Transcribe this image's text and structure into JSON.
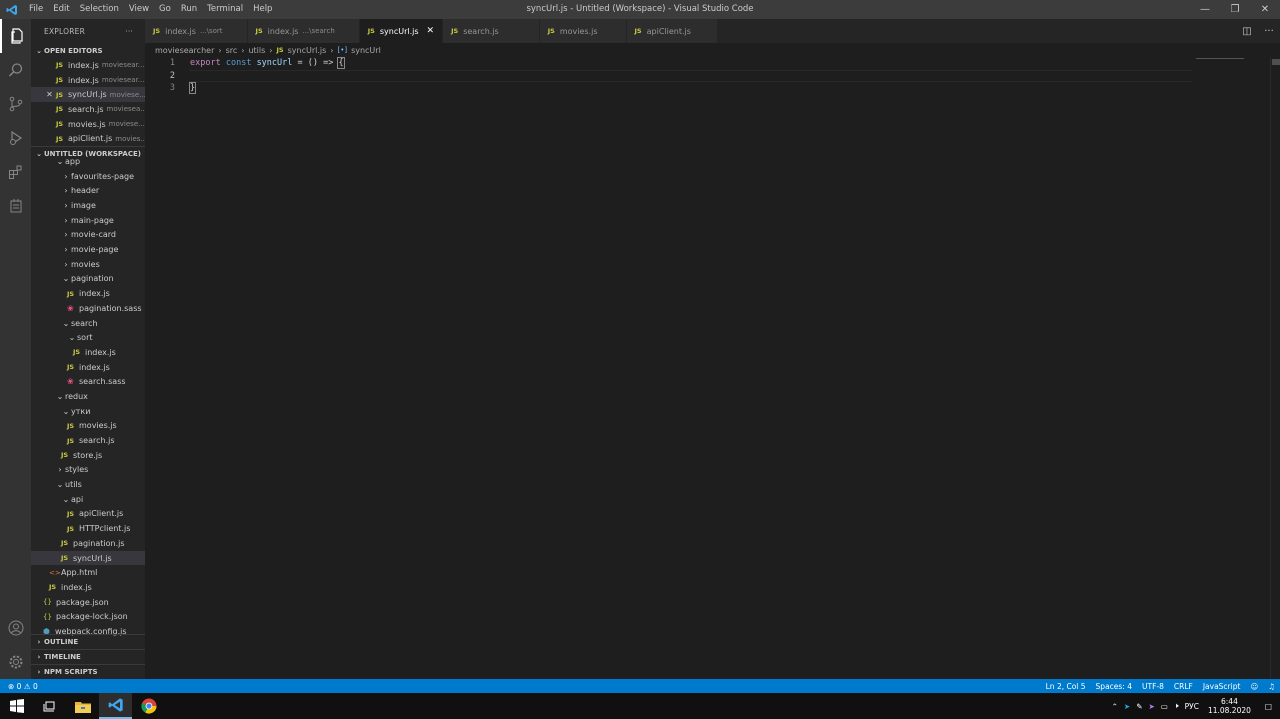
{
  "app": {
    "title": "syncUrl.js - Untitled (Workspace) - Visual Studio Code",
    "logo_icon": "vscode-logo-icon",
    "menu": [
      "File",
      "Edit",
      "Selection",
      "View",
      "Go",
      "Run",
      "Terminal",
      "Help"
    ],
    "window_controls": [
      "minimize-icon",
      "restore-icon",
      "close-icon"
    ]
  },
  "activity_bar": {
    "top": [
      "files-icon",
      "search-icon",
      "source-control-icon",
      "run-debug-icon",
      "extensions-icon",
      "remote-icon"
    ],
    "bottom": [
      "account-icon",
      "gear-icon"
    ]
  },
  "sidebar": {
    "header": "EXPLORER",
    "more": "···",
    "open_editors_title": "OPEN EDITORS",
    "open_editors": [
      {
        "name": "index.js",
        "desc": "moviesear..."
      },
      {
        "name": "index.js",
        "desc": "moviesear..."
      },
      {
        "name": "syncUrl.js",
        "desc": "moviese..."
      },
      {
        "name": "search.js",
        "desc": "moviesea..."
      },
      {
        "name": "movies.js",
        "desc": "moviese..."
      },
      {
        "name": "apiClient.js",
        "desc": "movies..."
      }
    ],
    "workspace_title": "UNTITLED (WORKSPACE)",
    "tree": [
      {
        "label": "app",
        "kind": "folder-open",
        "indent": 0
      },
      {
        "label": "favourites-page",
        "kind": "folder",
        "indent": 1
      },
      {
        "label": "header",
        "kind": "folder",
        "indent": 1
      },
      {
        "label": "image",
        "kind": "folder",
        "indent": 1
      },
      {
        "label": "main-page",
        "kind": "folder",
        "indent": 1
      },
      {
        "label": "movie-card",
        "kind": "folder",
        "indent": 1
      },
      {
        "label": "movie-page",
        "kind": "folder",
        "indent": 1
      },
      {
        "label": "movies",
        "kind": "folder",
        "indent": 1
      },
      {
        "label": "pagination",
        "kind": "folder-open",
        "indent": 1
      },
      {
        "label": "index.js",
        "kind": "js",
        "indent": 2
      },
      {
        "label": "pagination.sass",
        "kind": "sass",
        "indent": 2
      },
      {
        "label": "search",
        "kind": "folder-open",
        "indent": 1
      },
      {
        "label": "sort",
        "kind": "folder-open",
        "indent": 2
      },
      {
        "label": "index.js",
        "kind": "js",
        "indent": 3
      },
      {
        "label": "index.js",
        "kind": "js",
        "indent": 2
      },
      {
        "label": "search.sass",
        "kind": "sass",
        "indent": 2
      },
      {
        "label": "redux",
        "kind": "folder-open",
        "indent": 0
      },
      {
        "label": "утки",
        "kind": "folder-open",
        "indent": 1
      },
      {
        "label": "movies.js",
        "kind": "js",
        "indent": 2
      },
      {
        "label": "search.js",
        "kind": "js",
        "indent": 2
      },
      {
        "label": "store.js",
        "kind": "js",
        "indent": 1
      },
      {
        "label": "styles",
        "kind": "folder",
        "indent": 0
      },
      {
        "label": "utils",
        "kind": "folder-open",
        "indent": 0
      },
      {
        "label": "api",
        "kind": "folder-open",
        "indent": 1
      },
      {
        "label": "apiClient.js",
        "kind": "js",
        "indent": 2
      },
      {
        "label": "HTTPclient.js",
        "kind": "js",
        "indent": 2
      },
      {
        "label": "pagination.js",
        "kind": "js",
        "indent": 1
      },
      {
        "label": "syncUrl.js",
        "kind": "js",
        "indent": 1,
        "selected": true
      },
      {
        "label": "App.html",
        "kind": "html",
        "indent": -1
      },
      {
        "label": "index.js",
        "kind": "js",
        "indent": -1
      },
      {
        "label": "package.json",
        "kind": "json",
        "indent": -2
      },
      {
        "label": "package-lock.json",
        "kind": "json",
        "indent": -2
      },
      {
        "label": "webpack.config.js",
        "kind": "webpack",
        "indent": -2
      }
    ],
    "outline_title": "OUTLINE",
    "timeline_title": "TIMELINE",
    "npm_title": "NPM SCRIPTS"
  },
  "tabs": [
    {
      "name": "index.js",
      "desc": "...\\sort",
      "active": false
    },
    {
      "name": "index.js",
      "desc": "...\\search",
      "active": false
    },
    {
      "name": "syncUrl.js",
      "desc": "",
      "active": true
    },
    {
      "name": "search.js",
      "desc": "",
      "active": false
    },
    {
      "name": "movies.js",
      "desc": "",
      "active": false
    },
    {
      "name": "apiClient.js",
      "desc": "",
      "active": false
    }
  ],
  "breadcrumb": {
    "parts": [
      "moviesearcher",
      "src",
      "utils",
      "syncUrl.js",
      "syncUrl"
    ]
  },
  "editor": {
    "line_numbers": [
      "1",
      "2",
      "3"
    ],
    "line1": {
      "kw": "export",
      "st": "const",
      "name": "syncUrl",
      "rest": " = () => ",
      "brace": "{"
    },
    "line3": "}"
  },
  "status": {
    "errors": "0",
    "warnings": "0",
    "position": "Ln 2, Col 5",
    "spaces": "Spaces: 4",
    "encoding": "UTF-8",
    "eol": "CRLF",
    "language": "JavaScript"
  },
  "taskbar": {
    "lang": "РУС",
    "time": "6:44",
    "date": "11.08.2020"
  },
  "colors": {
    "accent": "#007acc",
    "js_icon": "#cbcb41",
    "keyword": "#c586c0",
    "storage": "#569cd6"
  }
}
